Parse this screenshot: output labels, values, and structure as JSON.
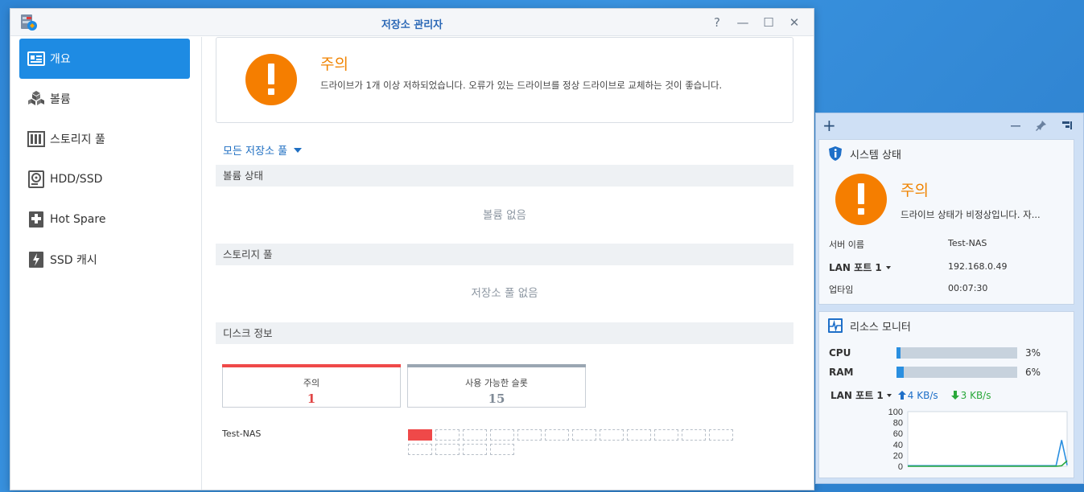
{
  "window": {
    "title": "저장소 관리자",
    "controls": [
      "?",
      "—",
      "☐",
      "✕"
    ]
  },
  "sidebar": {
    "items": [
      {
        "label": "개요",
        "icon": "overview-icon",
        "active": true
      },
      {
        "label": "볼륨",
        "icon": "volume-icon",
        "active": false
      },
      {
        "label": "스토리지 풀",
        "icon": "storage-pool-icon",
        "active": false
      },
      {
        "label": "HDD/SSD",
        "icon": "hdd-icon",
        "active": false
      },
      {
        "label": "Hot Spare",
        "icon": "hot-spare-icon",
        "active": false
      },
      {
        "label": "SSD 캐시",
        "icon": "ssd-cache-icon",
        "active": false
      }
    ]
  },
  "alert": {
    "title": "주의",
    "message": "드라이브가 1개 이상 저하되었습니다. 오류가 있는 드라이브를 정상 드라이브로 교체하는 것이 좋습니다."
  },
  "pool_selector": {
    "label": "모든 저장소 풀"
  },
  "sections": {
    "volume_status": {
      "header": "볼륨 상태",
      "empty": "볼륨 없음"
    },
    "storage_pool": {
      "header": "스토리지 풀",
      "empty": "저장소 풀 없음"
    },
    "disk_info": {
      "header": "디스크 정보"
    }
  },
  "disk_cards": [
    {
      "label": "주의",
      "count": "1",
      "color": "#ef4949"
    },
    {
      "label": "사용 가능한 슬롯",
      "count": "15",
      "color": "#9aa6b2"
    }
  ],
  "nas": {
    "name": "Test-NAS",
    "slots_total": 16,
    "slots_filled": 1
  },
  "widgets": {
    "system_status": {
      "title": "시스템 상태",
      "status_title": "주의",
      "status_message": "드라이브 상태가 비정상입니다. 자...",
      "server_name_label": "서버 이름",
      "server_name": "Test-NAS",
      "lan_label": "LAN 포트 1",
      "lan_value": "192.168.0.49",
      "uptime_label": "업타임",
      "uptime_value": "00:07:30"
    },
    "resource_monitor": {
      "title": "리소스 모니터",
      "cpu_label": "CPU",
      "cpu_value": "3%",
      "cpu_pct": 3,
      "ram_label": "RAM",
      "ram_value": "6%",
      "ram_pct": 6,
      "lan_label": "LAN 포트 1",
      "upload": "4 KB/s",
      "download": "3 KB/s"
    }
  },
  "chart_data": {
    "type": "line",
    "title": "",
    "xlabel": "",
    "ylabel": "",
    "ylim": [
      0,
      100
    ],
    "yticks": [
      "100",
      "80",
      "60",
      "40",
      "20",
      "0"
    ],
    "x": [
      0,
      1,
      2,
      3,
      4,
      5,
      6,
      7,
      8,
      9,
      10,
      11,
      12,
      13,
      14,
      15,
      16,
      17,
      18,
      19,
      20,
      21,
      22,
      23,
      24,
      25,
      26,
      27,
      28,
      29
    ],
    "series": [
      {
        "color": "#2a8fe0",
        "values": [
          1,
          1,
          1,
          1,
          1,
          1,
          1,
          1,
          1,
          1,
          1,
          1,
          1,
          1,
          1,
          1,
          1,
          1,
          1,
          1,
          1,
          1,
          1,
          1,
          1,
          1,
          1,
          1,
          48,
          2
        ]
      },
      {
        "color": "#2aa83a",
        "values": [
          0,
          0,
          0,
          0,
          0,
          0,
          0,
          0,
          0,
          0,
          0,
          0,
          0,
          0,
          0,
          0,
          0,
          0,
          0,
          0,
          0,
          0,
          0,
          0,
          0,
          0,
          0,
          0,
          1,
          10
        ]
      }
    ],
    "grid": false
  }
}
